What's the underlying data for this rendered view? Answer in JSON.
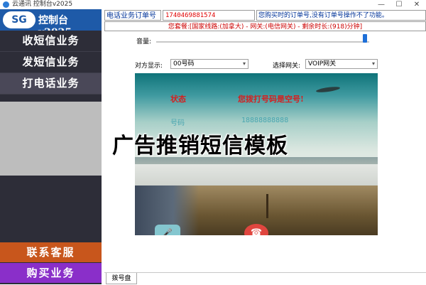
{
  "window": {
    "title": "云通讯 控制台v2025",
    "minimize_glyph": "—",
    "restore_glyph": "☐",
    "close_glyph": "✕"
  },
  "logo": {
    "badge": "SG",
    "text": "控制台v2025"
  },
  "sidebar": {
    "items": [
      {
        "label": "收短信业务"
      },
      {
        "label": "发短信业务"
      },
      {
        "label": "打电话业务"
      }
    ],
    "contact_label": "联系客服",
    "buy_label": "购买业务",
    "contact_color": "#c8561c",
    "buy_color": "#8a2fc9"
  },
  "header": {
    "order_label": "电话业务订单号",
    "order_value": "1740469881574",
    "order_message": "您购买时的订单号,没有订单号操作不了功能。",
    "package_text": "您套餐:[国家线路:(加拿大) - 网关:(电信网关) - 剩余时长:(918)分钟]"
  },
  "controls": {
    "volume_label": "音量:",
    "volume_level": 0.98,
    "display_label": "对方显示:",
    "display_value": "00号码",
    "gateway_label": "选择网关:",
    "gateway_value": "VOIP网关"
  },
  "call": {
    "status_label": "状态",
    "status_value": "您拨打号码是空号!",
    "number_label": "号码",
    "number_value": "18888888888",
    "mic_glyph": "🎤",
    "hangup_glyph": "☎"
  },
  "tabs": {
    "dialpad": "拨号盘"
  },
  "overlay_text": "广告推销短信模板",
  "colors": {
    "accent_blue": "#1e5aa8",
    "alert_red": "#d42020",
    "label_blue": "#003399"
  }
}
